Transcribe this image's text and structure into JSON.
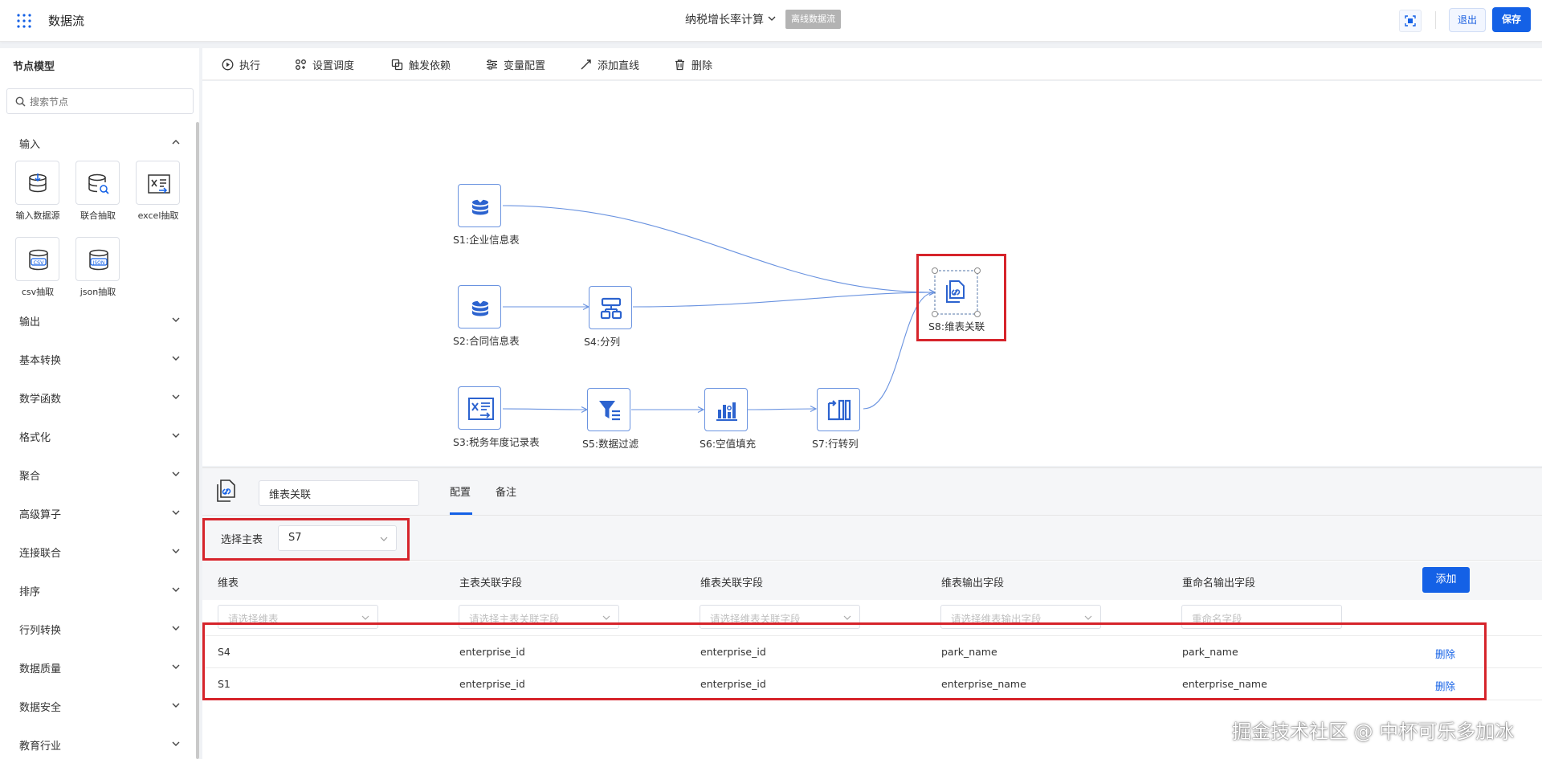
{
  "header": {
    "app_title": "数据流",
    "flow_name": "纳税增长率计算",
    "flow_badge": "离线数据流",
    "exit_label": "退出",
    "save_label": "保存"
  },
  "sidebar": {
    "title": "节点模型",
    "search_placeholder": "搜索节点",
    "input_category": "输入",
    "input_tools": [
      {
        "label": "输入数据源",
        "icon": "database-download-icon"
      },
      {
        "label": "联合抽取",
        "icon": "database-search-icon"
      },
      {
        "label": "excel抽取",
        "icon": "excel-icon"
      },
      {
        "label": "csv抽取",
        "icon": "csv-icon"
      },
      {
        "label": "json抽取",
        "icon": "json-icon"
      }
    ],
    "categories": [
      "输出",
      "基本转换",
      "数学函数",
      "格式化",
      "聚合",
      "高级算子",
      "连接联合",
      "排序",
      "行列转换",
      "数据质量",
      "数据安全",
      "教育行业"
    ]
  },
  "toolbar": {
    "items": [
      "执行",
      "设置调度",
      "触发依赖",
      "变量配置",
      "添加直线",
      "删除"
    ]
  },
  "canvas": {
    "nodes": [
      {
        "id": "S1",
        "label": "S1:企业信息表",
        "icon": "database-download-icon"
      },
      {
        "id": "S2",
        "label": "S2:合同信息表",
        "icon": "database-download-icon"
      },
      {
        "id": "S3",
        "label": "S3:税务年度记录表",
        "icon": "excel-icon"
      },
      {
        "id": "S4",
        "label": "S4:分列",
        "icon": "split-columns-icon"
      },
      {
        "id": "S5",
        "label": "S5:数据过滤",
        "icon": "filter-icon"
      },
      {
        "id": "S6",
        "label": "S6:空值填充",
        "icon": "bar-chart-icon"
      },
      {
        "id": "S7",
        "label": "S7:行转列",
        "icon": "row-to-column-icon"
      },
      {
        "id": "S8",
        "label": "S8:维表关联",
        "icon": "dimension-join-icon"
      }
    ]
  },
  "panel": {
    "node_name": "维表关联",
    "tabs": [
      "配置",
      "备注"
    ],
    "master_label": "选择主表",
    "master_value": "S7",
    "columns": [
      "维表",
      "主表关联字段",
      "维表关联字段",
      "维表输出字段",
      "重命名输出字段"
    ],
    "add_label": "添加",
    "filters": [
      "请选择维表",
      "请选择主表关联字段",
      "请选择维表关联字段",
      "请选择维表输出字段",
      "重命名字段"
    ],
    "rows": [
      {
        "dim": "S4",
        "master_key": "enterprise_id",
        "dim_key": "enterprise_id",
        "dim_out": "park_name",
        "rename": "park_name",
        "action": "删除"
      },
      {
        "dim": "S1",
        "master_key": "enterprise_id",
        "dim_key": "enterprise_id",
        "dim_out": "enterprise_name",
        "rename": "enterprise_name",
        "action": "删除"
      }
    ]
  },
  "watermark": "掘金技术社区 @ 中杯可乐多加冰",
  "colors": {
    "accent": "#1461e6",
    "highlight": "#d6242b",
    "edge": "#6a93e0"
  }
}
